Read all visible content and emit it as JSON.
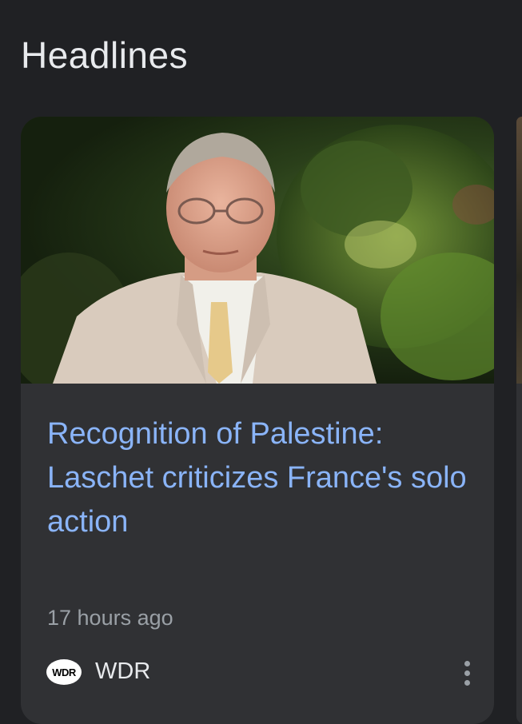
{
  "section": {
    "title": "Headlines"
  },
  "article": {
    "headline": "Recognition of Palestine: Laschet criticizes France's solo action",
    "timestamp": "17 hours ago",
    "source": {
      "name": "WDR",
      "logo_text": "WDR"
    },
    "more_icon": "more-vert-icon"
  },
  "colors": {
    "background": "#202124",
    "card": "#303134",
    "headline": "#8ab4f8",
    "timestamp": "#9aa0a6",
    "text": "#e8eaed"
  }
}
